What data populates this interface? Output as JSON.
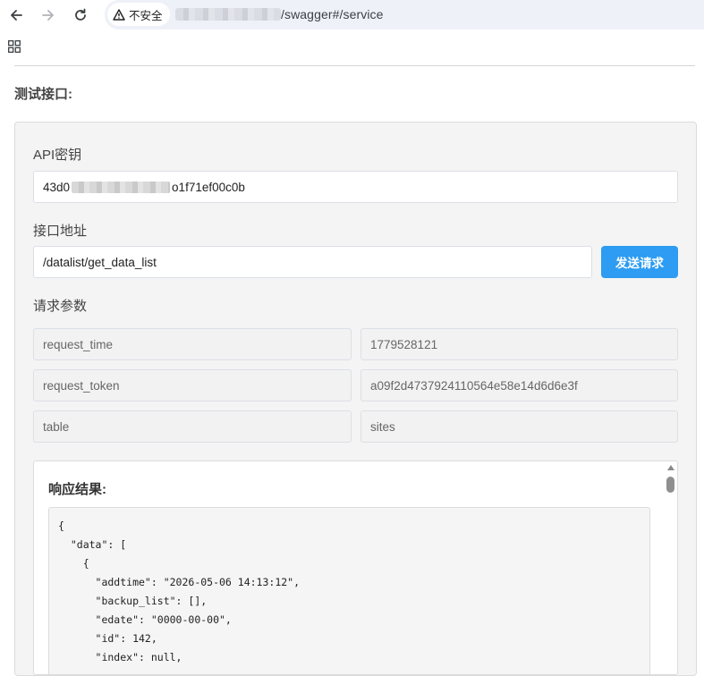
{
  "browser": {
    "security_label": "不安全",
    "url_path": "/swagger#/service",
    "icons": [
      "back-arrow-icon",
      "forward-arrow-icon",
      "reload-icon",
      "warning-triangle-icon",
      "apps-grid-icon"
    ]
  },
  "page": {
    "section_title": "测试接口:",
    "api_key": {
      "label": "API密钥",
      "value_prefix": "43d0",
      "value_suffix": "o1f71ef00c0b"
    },
    "endpoint": {
      "label": "接口地址",
      "value": "/datalist/get_data_list",
      "send_button": "发送请求"
    },
    "params": {
      "label": "请求参数",
      "rows": [
        {
          "key": "request_time",
          "value": "1779528121"
        },
        {
          "key": "request_token",
          "value": "a09f2d4737924110564e58e14d6d6e3f"
        },
        {
          "key": "table",
          "value": "sites"
        }
      ]
    },
    "response": {
      "title": "响应结果:",
      "code": "{\n  \"data\": [\n    {\n      \"addtime\": \"2026-05-06 14:13:12\",\n      \"backup_list\": [],\n      \"edate\": \"0000-00-00\",\n      \"id\": 142,\n      \"index\": null,"
    }
  },
  "colors": {
    "primary_button": "#2d9cf2",
    "panel_bg": "#f4f4f4"
  }
}
